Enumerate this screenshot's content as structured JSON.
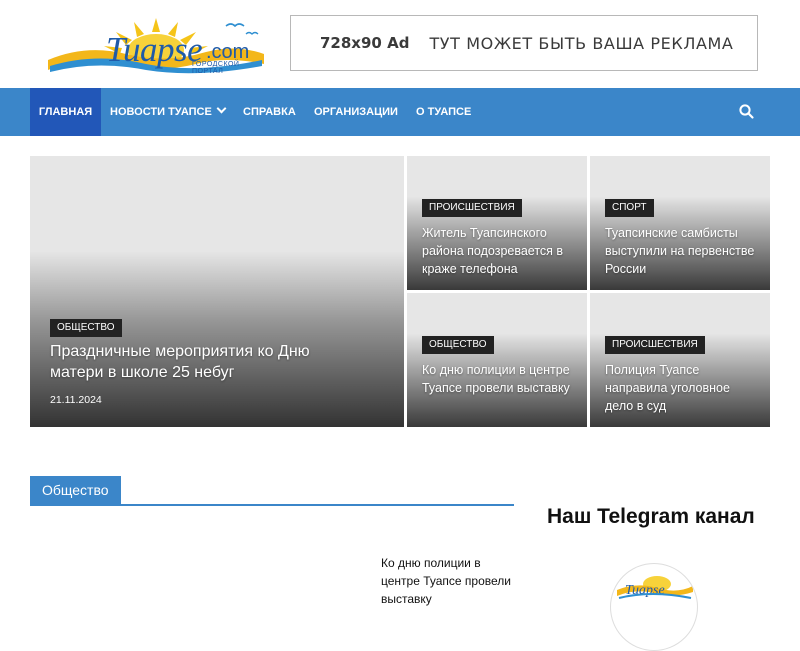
{
  "logo": {
    "text": "Tuapse",
    "domain": ".com",
    "subtitle": "городской портал"
  },
  "ad": {
    "size": "728x90 Ad",
    "text": "ТУТ МОЖЕТ БЫТЬ ВАША РЕКЛАМА"
  },
  "nav": {
    "items": [
      {
        "label": "ГЛАВНАЯ",
        "active": true
      },
      {
        "label": "НОВОСТИ ТУАПСЕ",
        "dropdown": true
      },
      {
        "label": "СПРАВКА"
      },
      {
        "label": "ОРГАНИЗАЦИИ"
      },
      {
        "label": "О ТУАПСЕ"
      }
    ],
    "search_icon": "search-icon"
  },
  "hero": {
    "main": {
      "category": "ОБЩЕСТВО",
      "title": "Праздничные мероприятия ко Дню матери в школе 25 небуг",
      "date": "21.11.2024"
    },
    "tiles": [
      {
        "category": "ПРОИСШЕСТВИЯ",
        "title": "Житель Туапсинского района подозревается в краже телефона"
      },
      {
        "category": "СПОРТ",
        "title": "Туапсинские самбисты выступили на первенстве России"
      },
      {
        "category": "ОБЩЕСТВО",
        "title": "Ко дню полиции в центре Туапсе провели выставку"
      },
      {
        "category": "ПРОИСШЕСТВИЯ",
        "title": "Полиция Туапсе направила уголовное дело в суд"
      }
    ]
  },
  "section": {
    "title": "Общество",
    "items": [
      {
        "title": "Ко дню полиции в центре Туапсе провели выставку"
      }
    ]
  },
  "sidebar": {
    "widget_title": "Наш Telegram канал"
  },
  "colors": {
    "nav_bg": "#3b86c9",
    "nav_active": "#2257b8",
    "category_bg": "#222222",
    "logo_blue": "#1f5aa8",
    "logo_sun": "#f5c419"
  }
}
